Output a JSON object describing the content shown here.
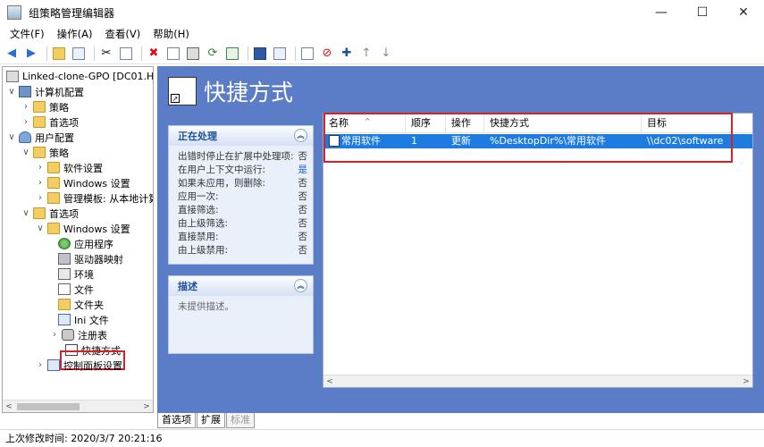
{
  "window": {
    "title": "组策略管理编辑器"
  },
  "menu": [
    "文件(F)",
    "操作(A)",
    "查看(V)",
    "帮助(H)"
  ],
  "tree": {
    "items": [
      {
        "label": "Linked-clone-GPO [DC01.HEL",
        "exp": ""
      },
      {
        "label": "计算机配置",
        "exp": "∨"
      },
      {
        "label": "策略",
        "exp": "›"
      },
      {
        "label": "首选项",
        "exp": "›"
      },
      {
        "label": "用户配置",
        "exp": "∨"
      },
      {
        "label": "策略",
        "exp": "∨"
      },
      {
        "label": "软件设置",
        "exp": "›"
      },
      {
        "label": "Windows 设置",
        "exp": "›"
      },
      {
        "label": "管理模板: 从本地计算",
        "exp": "›"
      },
      {
        "label": "首选项",
        "exp": "∨"
      },
      {
        "label": "Windows 设置",
        "exp": "∨"
      },
      {
        "label": "应用程序",
        "exp": ""
      },
      {
        "label": "驱动器映射",
        "exp": ""
      },
      {
        "label": "环境",
        "exp": ""
      },
      {
        "label": "文件",
        "exp": ""
      },
      {
        "label": "文件夹",
        "exp": ""
      },
      {
        "label": "Ini 文件",
        "exp": ""
      },
      {
        "label": "注册表",
        "exp": "›"
      },
      {
        "label": "快捷方式",
        "exp": ""
      },
      {
        "label": "控制面板设置",
        "exp": "›"
      }
    ]
  },
  "right": {
    "title": "快捷方式",
    "processing_panel": {
      "header": "正在处理",
      "rows": [
        {
          "label": "出错时停止在扩展中处理项:",
          "value": "否"
        },
        {
          "label": "在用户上下文中运行:",
          "value": "是"
        },
        {
          "label": "如果未应用，则删除:",
          "value": "否"
        },
        {
          "label": "应用一次:",
          "value": "否"
        },
        {
          "label": "直接筛选:",
          "value": "否"
        },
        {
          "label": "由上级筛选:",
          "value": "否"
        },
        {
          "label": "直接禁用:",
          "value": "否"
        },
        {
          "label": "由上级禁用:",
          "value": "否"
        }
      ]
    },
    "description_panel": {
      "header": "描述",
      "text": "未提供描述。"
    },
    "list": {
      "columns": [
        "名称",
        "顺序",
        "操作",
        "快捷方式",
        "目标"
      ],
      "rows": [
        {
          "name": "常用软件",
          "order": "1",
          "action": "更新",
          "shortcut": "%DesktopDir%\\常用软件",
          "target": "\\\\dc02\\software"
        }
      ]
    }
  },
  "tabs": [
    "首选项",
    "扩展",
    "标准"
  ],
  "status": "上次修改时间: 2020/3/7 20:21:16"
}
